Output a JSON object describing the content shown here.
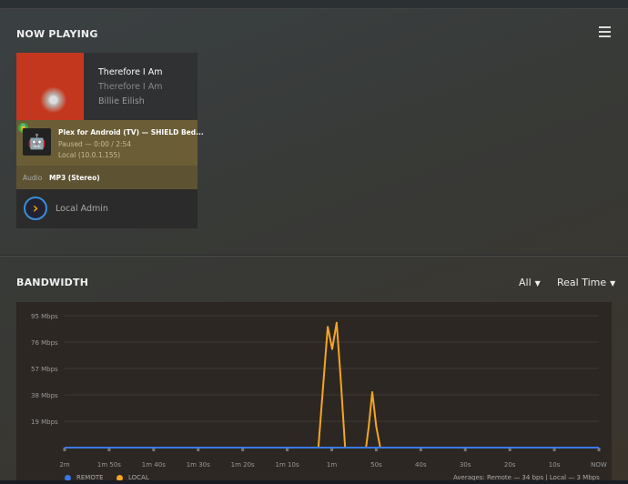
{
  "now_playing": {
    "title": "NOW PLAYING",
    "track": "Therefore I Am",
    "album": "Therefore I Am",
    "artist": "Billie Eilish",
    "player": "Plex for Android (TV)  —  SHIELD Bed...",
    "state": "Paused — 0:00 / 2:54",
    "location": "Local (10.0.1.155)",
    "audio_label": "Audio",
    "audio_value": "MP3 (Stereo)",
    "user": "Local Admin"
  },
  "bandwidth": {
    "title": "BANDWIDTH",
    "filter": "All",
    "range": "Real Time",
    "averages": "Averages: Remote — 34 bps | Local — 3 Mbps"
  },
  "chart_data": {
    "type": "line",
    "ylabel": "Mbps",
    "ylim": [
      0,
      95
    ],
    "xlim_seconds_ago": [
      120,
      0
    ],
    "y_ticks": [
      "19 Mbps",
      "38 Mbps",
      "57 Mbps",
      "76 Mbps",
      "95 Mbps"
    ],
    "y_tick_values": [
      19,
      38,
      57,
      76,
      95
    ],
    "x_ticks": [
      "2m",
      "1m 50s",
      "1m 40s",
      "1m 30s",
      "1m 20s",
      "1m 10s",
      "1m",
      "50s",
      "40s",
      "30s",
      "20s",
      "10s",
      "NOW"
    ],
    "x_tick_values": [
      120,
      110,
      100,
      90,
      80,
      70,
      60,
      50,
      40,
      30,
      20,
      10,
      0
    ],
    "legend": [
      "REMOTE",
      "LOCAL"
    ],
    "series": [
      {
        "name": "REMOTE",
        "color": "#3b78e7",
        "points": [
          [
            120,
            0
          ],
          [
            0,
            0
          ]
        ]
      },
      {
        "name": "LOCAL",
        "color": "#f5a623",
        "points": [
          [
            120,
            0
          ],
          [
            63,
            0
          ],
          [
            61.8,
            50
          ],
          [
            60.9,
            87
          ],
          [
            59.9,
            71
          ],
          [
            58.9,
            90
          ],
          [
            58,
            50
          ],
          [
            57,
            0
          ],
          [
            52.3,
            0
          ],
          [
            51.7,
            15
          ],
          [
            50.9,
            40
          ],
          [
            50,
            15
          ],
          [
            49.1,
            0
          ],
          [
            0,
            0
          ]
        ]
      }
    ]
  }
}
